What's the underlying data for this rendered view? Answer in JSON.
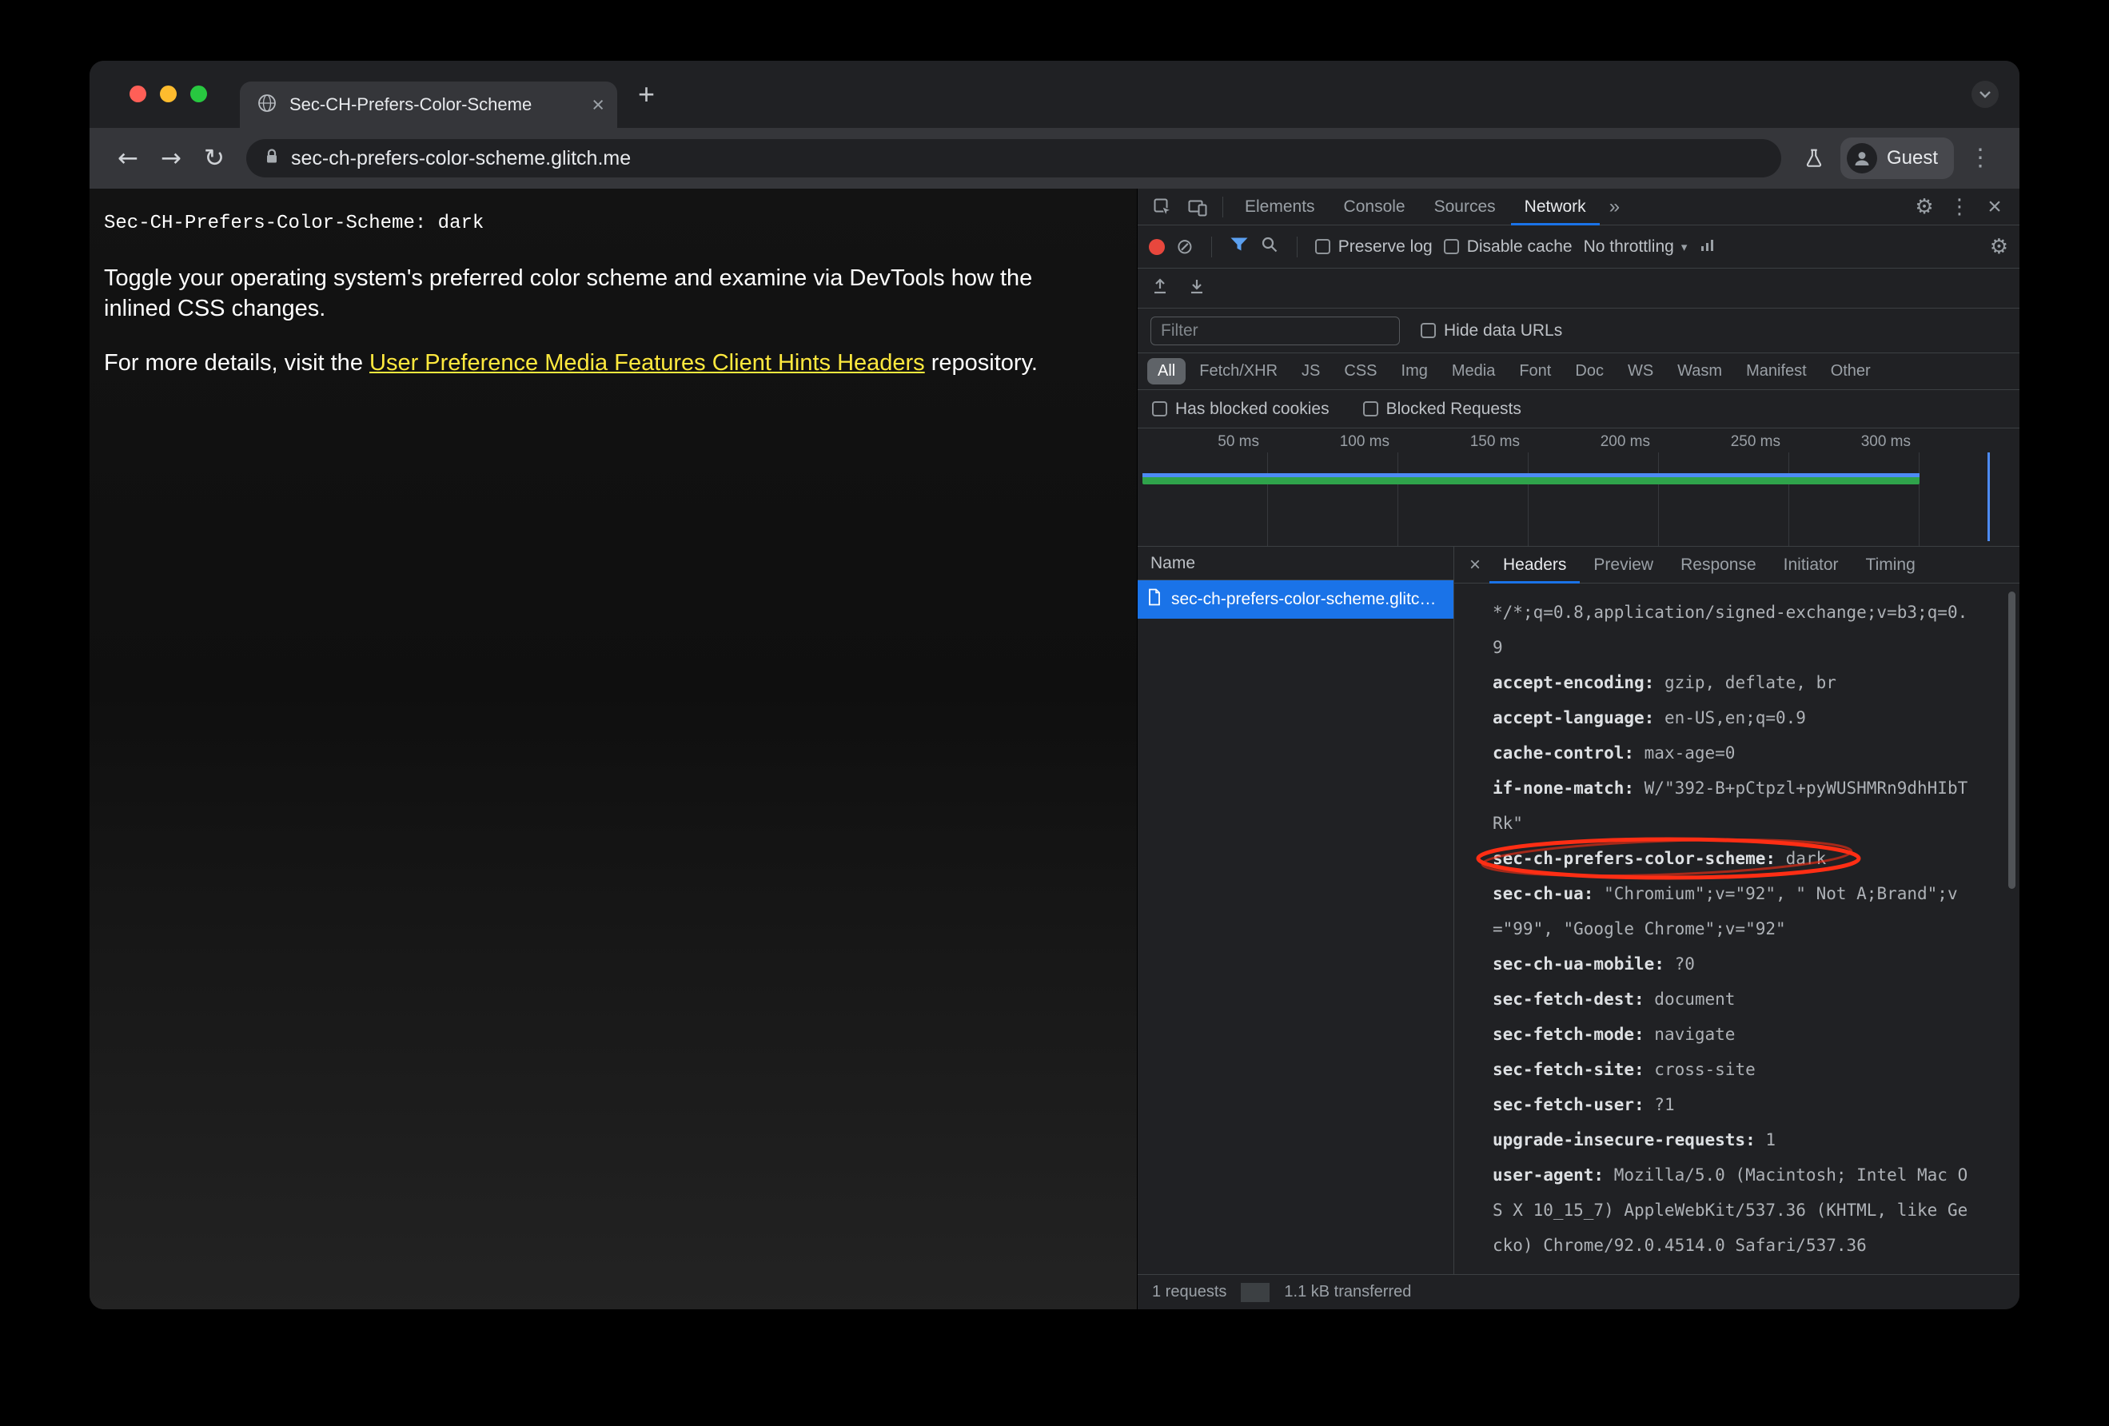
{
  "colors": {
    "accent_blue": "#1a73e8",
    "filter_blue": "#5ba0f0",
    "link_yellow": "#ffe93e",
    "record_red": "#e8473d",
    "annotation_red": "#ff2e14",
    "bar_green": "#2fa34b",
    "bar_blue": "#4d8bf5",
    "traffic_red": "#ff5f57",
    "traffic_yellow": "#febc2e",
    "traffic_green": "#28c840"
  },
  "icons": {
    "gear": "⚙",
    "kebab": "⋮",
    "close": "×",
    "tab_close": "×",
    "details_close": "×",
    "block": "⊘",
    "new_tab": "+",
    "more_tabs": "»",
    "caret": "▾",
    "back": "←",
    "forward": "→",
    "reload": "↻"
  },
  "window": {
    "tab": {
      "title": "Sec-CH-Prefers-Color-Scheme"
    },
    "toolbar": {
      "url": "sec-ch-prefers-color-scheme.glitch.me",
      "profile_label": "Guest"
    }
  },
  "page": {
    "mono_line": "Sec-CH-Prefers-Color-Scheme: dark",
    "para1": "Toggle your operating system's preferred color scheme and examine via DevTools how the inlined CSS changes.",
    "para2_prefix": "For more details, visit the ",
    "para2_link": "User Preference Media Features Client Hints Headers",
    "para2_suffix": " repository."
  },
  "devtools": {
    "tabs": [
      "Elements",
      "Console",
      "Sources",
      "Network"
    ],
    "selected_tab": "Network",
    "net_toolbar": {
      "preserve_log": "Preserve log",
      "disable_cache": "Disable cache",
      "throttling": "No throttling"
    },
    "filter": {
      "placeholder": "Filter",
      "hide_data_urls": "Hide data URLs"
    },
    "filter_chips": [
      "All",
      "Fetch/XHR",
      "JS",
      "CSS",
      "Img",
      "Media",
      "Font",
      "Doc",
      "WS",
      "Wasm",
      "Manifest",
      "Other"
    ],
    "filter_chips_selected": 0,
    "blocked": [
      "Has blocked cookies",
      "Blocked Requests"
    ],
    "overview": {
      "ticks": [
        "50 ms",
        "100 ms",
        "150 ms",
        "200 ms",
        "250 ms",
        "300 ms"
      ]
    },
    "requests": {
      "column": "Name",
      "rows": [
        {
          "name": "sec-ch-prefers-color-scheme.glitch.me"
        }
      ]
    },
    "detail_tabs": [
      "Headers",
      "Preview",
      "Response",
      "Initiator",
      "Timing"
    ],
    "selected_detail_tab": "Headers",
    "request_headers": [
      {
        "name": "",
        "value": "*/*;q=0.8,application/signed-exchange;v=b3;q=0.9"
      },
      {
        "name": "accept-encoding",
        "value": "gzip, deflate, br"
      },
      {
        "name": "accept-language",
        "value": "en-US,en;q=0.9"
      },
      {
        "name": "cache-control",
        "value": "max-age=0"
      },
      {
        "name": "if-none-match",
        "value": "W/\"392-B+pCtpzl+pyWUSHMRn9dhHIbTRk\""
      },
      {
        "name": "sec-ch-prefers-color-scheme",
        "value": "dark",
        "circled": true
      },
      {
        "name": "sec-ch-ua",
        "value": "\"Chromium\";v=\"92\", \" Not A;Brand\";v=\"99\", \"Google Chrome\";v=\"92\""
      },
      {
        "name": "sec-ch-ua-mobile",
        "value": "?0"
      },
      {
        "name": "sec-fetch-dest",
        "value": "document"
      },
      {
        "name": "sec-fetch-mode",
        "value": "navigate"
      },
      {
        "name": "sec-fetch-site",
        "value": "cross-site"
      },
      {
        "name": "sec-fetch-user",
        "value": "?1"
      },
      {
        "name": "upgrade-insecure-requests",
        "value": "1"
      },
      {
        "name": "user-agent",
        "value": "Mozilla/5.0 (Macintosh; Intel Mac OS X 10_15_7) AppleWebKit/537.36 (KHTML, like Gecko) Chrome/92.0.4514.0 Safari/537.36"
      }
    ],
    "status": {
      "requests": "1 requests",
      "transferred": "1.1 kB transferred"
    }
  }
}
